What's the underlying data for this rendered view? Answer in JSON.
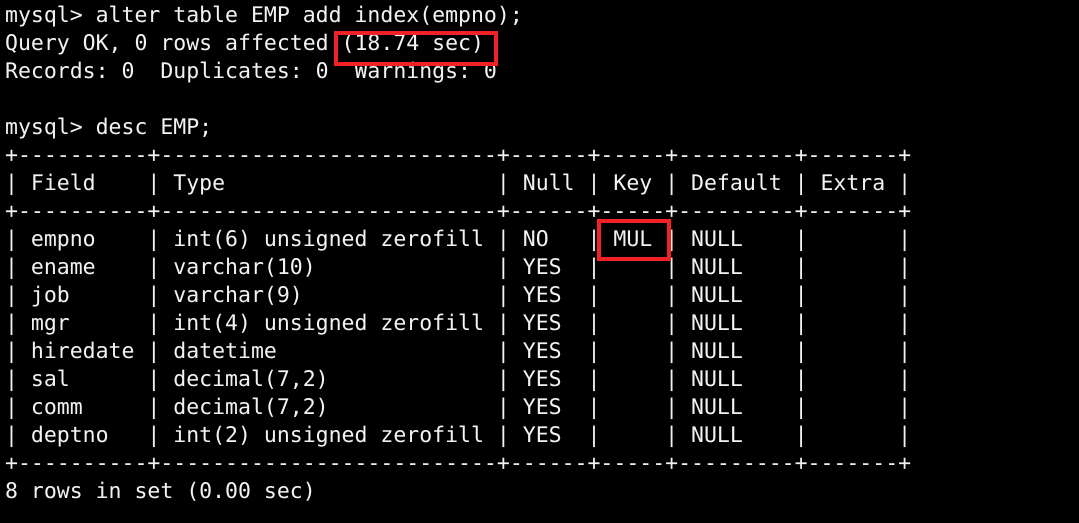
{
  "terminal": {
    "prompt": "mysql>",
    "background_color": "#000000",
    "text_color": "#f2f2f2",
    "highlight_color": "#f32124",
    "lines": [
      "mysql> alter table EMP add index(empno);",
      "Query OK, 0 rows affected (18.74 sec)",
      "Records: 0  Duplicates: 0  Warnings: 0",
      "",
      "mysql> desc EMP;",
      "+----------+------------------------+------+-----+---------+-------+",
      "| Field    | Type                   | Null | Key | Default | Extra |",
      "+----------+------------------------+------+-----+---------+-------+",
      "| empno    | int(6) unsigned zerofill | NO   | MUL | NULL    |       |",
      "| ename    | varchar(10)            | YES  |     | NULL    |       |",
      "| job      | varchar(9)             | YES  |     | NULL    |       |",
      "| mgr      | int(4) unsigned zerofill | YES  |     | NULL    |       |",
      "| hiredate | datetime               | YES  |     | NULL    |       |",
      "| sal      | decimal(7,2)           | YES  |     | NULL    |       |",
      "| comm     | decimal(7,2)           | YES  |     | NULL    |       |",
      "| deptno   | int(2) unsigned zerofill | YES  |     | NULL    |       |",
      "+----------+------------------------+------+-----+---------+-------+",
      "8 rows in set (0.00 sec)"
    ],
    "rendered_lines": [
      "mysql> alter table EMP add index(empno);",
      "Query OK, 0 rows affected (18.74 sec)",
      "Records: 0  Duplicates: 0  Warnings: 0",
      "",
      "mysql> desc EMP;",
      "+----------+--------------------------+------+-----+---------+-------+",
      "| Field    | Type                     | Null | Key | Default | Extra |",
      "+----------+--------------------------+------+-----+---------+-------+",
      "| empno    | int(6) unsigned zerofill | NO   | MUL | NULL    |       |",
      "| ename    | varchar(10)              | YES  |     | NULL    |       |",
      "| job      | varchar(9)               | YES  |     | NULL    |       |",
      "| mgr      | int(4) unsigned zerofill | YES  |     | NULL    |       |",
      "| hiredate | datetime                 | YES  |     | NULL    |       |",
      "| sal      | decimal(7,2)             | YES  |     | NULL    |       |",
      "| comm     | decimal(7,2)             | YES  |     | NULL    |       |",
      "| deptno   | int(2) unsigned zerofill | YES  |     | NULL    |       |",
      "+----------+--------------------------+------+-----+---------+-------+",
      "8 rows in set (0.00 sec)"
    ]
  },
  "commands": {
    "alter_statement": "alter table EMP add index(empno);",
    "desc_statement": "desc EMP;"
  },
  "results": {
    "alter": {
      "status": "Query OK, 0 rows affected",
      "duration": "(18.74 sec)",
      "duration_value": "18.74",
      "duration_unit": "sec",
      "records": "0",
      "duplicates": "0",
      "warnings": "0",
      "summary_line": "Records: 0  Duplicates: 0  Warnings: 0"
    },
    "desc": {
      "footer": "8 rows in set (0.00 sec)",
      "row_count": "8",
      "duration": "0.00 sec"
    }
  },
  "table": {
    "name": "EMP",
    "columns": [
      "Field",
      "Type",
      "Null",
      "Key",
      "Default",
      "Extra"
    ],
    "rows": [
      {
        "field": "empno",
        "type": "int(6) unsigned zerofill",
        "null": "NO",
        "key": "MUL",
        "default": "NULL",
        "extra": ""
      },
      {
        "field": "ename",
        "type": "varchar(10)",
        "null": "YES",
        "key": "",
        "default": "NULL",
        "extra": ""
      },
      {
        "field": "job",
        "type": "varchar(9)",
        "null": "YES",
        "key": "",
        "default": "NULL",
        "extra": ""
      },
      {
        "field": "mgr",
        "type": "int(4) unsigned zerofill",
        "null": "YES",
        "key": "",
        "default": "NULL",
        "extra": ""
      },
      {
        "field": "hiredate",
        "type": "datetime",
        "null": "YES",
        "key": "",
        "default": "NULL",
        "extra": ""
      },
      {
        "field": "sal",
        "type": "decimal(7,2)",
        "null": "YES",
        "key": "",
        "default": "NULL",
        "extra": ""
      },
      {
        "field": "comm",
        "type": "decimal(7,2)",
        "null": "YES",
        "key": "",
        "default": "NULL",
        "extra": ""
      },
      {
        "field": "deptno",
        "type": "int(2) unsigned zerofill",
        "null": "YES",
        "key": "",
        "default": "NULL",
        "extra": ""
      }
    ]
  },
  "annotations": [
    {
      "id": "box-sec",
      "label": "(18.74 sec)",
      "color": "#f32124",
      "shape": "rectangle-outline"
    },
    {
      "id": "box-mul",
      "label": "MUL",
      "color": "#f32124",
      "shape": "rectangle-outline"
    }
  ]
}
